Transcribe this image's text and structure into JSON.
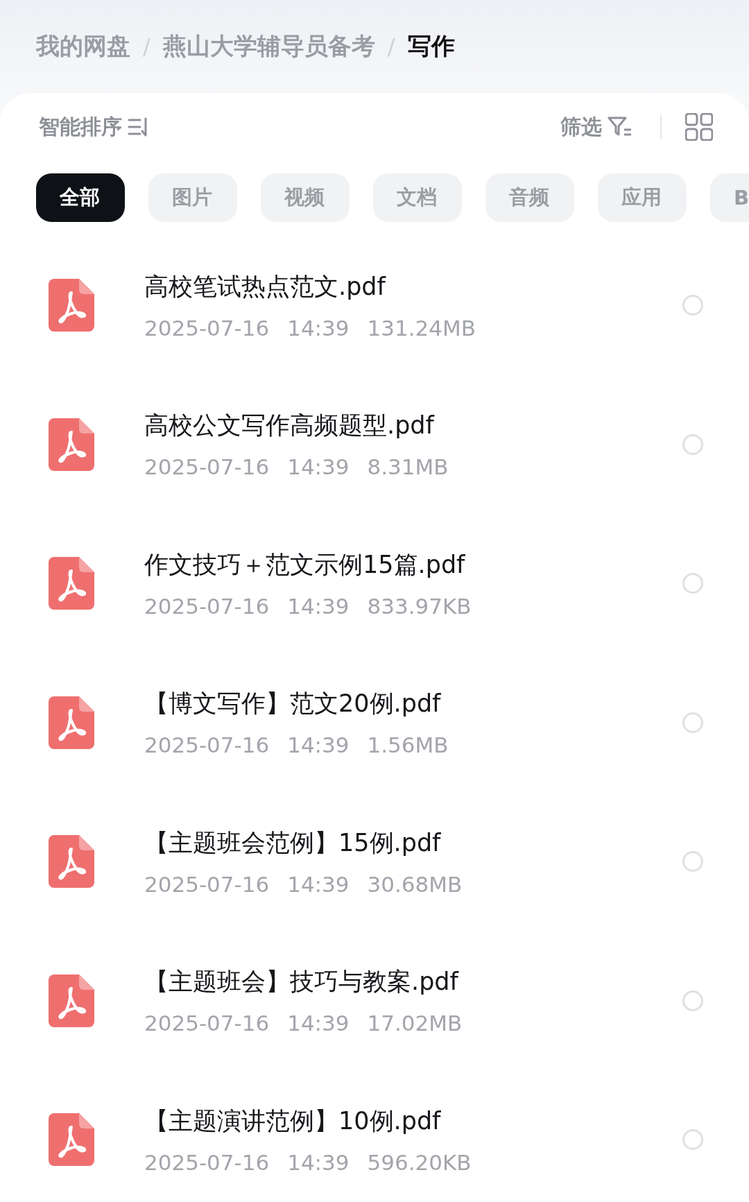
{
  "breadcrumb": [
    {
      "label": "我的网盘",
      "selected": false
    },
    {
      "separator": "/",
      "label": "燕山大学辅导员备考",
      "selected": false
    },
    {
      "separator": "/",
      "label": "写作",
      "selected": true
    }
  ],
  "toolbar": {
    "sort_label": "智能排序",
    "filter_label": "筛选"
  },
  "categories": [
    {
      "label": "全部",
      "selected": true
    },
    {
      "label": "图片",
      "selected": false
    },
    {
      "label": "视频",
      "selected": false
    },
    {
      "label": "文档",
      "selected": false
    },
    {
      "label": "音频",
      "selected": false
    },
    {
      "label": "应用",
      "selected": false
    },
    {
      "label": "B",
      "selected": false
    }
  ],
  "files": [
    {
      "name": "高校笔试热点范文.pdf",
      "date": "2025-07-16",
      "time": "14:39",
      "size": "131.24MB",
      "checked": false
    },
    {
      "name": "高校公文写作高频题型.pdf",
      "date": "2025-07-16",
      "time": "14:39",
      "size": "8.31MB",
      "checked": false
    },
    {
      "name": "作文技巧＋范文示例15篇.pdf",
      "date": "2025-07-16",
      "time": "14:39",
      "size": "833.97KB",
      "checked": false
    },
    {
      "name": "【博文写作】范文20例.pdf",
      "date": "2025-07-16",
      "time": "14:39",
      "size": "1.56MB",
      "checked": false
    },
    {
      "name": "【主题班会范例】15例.pdf",
      "date": "2025-07-16",
      "time": "14:39",
      "size": "30.68MB",
      "checked": false
    },
    {
      "name": "【主题班会】技巧与教案.pdf",
      "date": "2025-07-16",
      "time": "14:39",
      "size": "17.02MB",
      "checked": false
    },
    {
      "name": "【主题演讲范例】10例.pdf",
      "date": "2025-07-16",
      "time": "14:39",
      "size": "596.20KB",
      "checked": false
    }
  ]
}
